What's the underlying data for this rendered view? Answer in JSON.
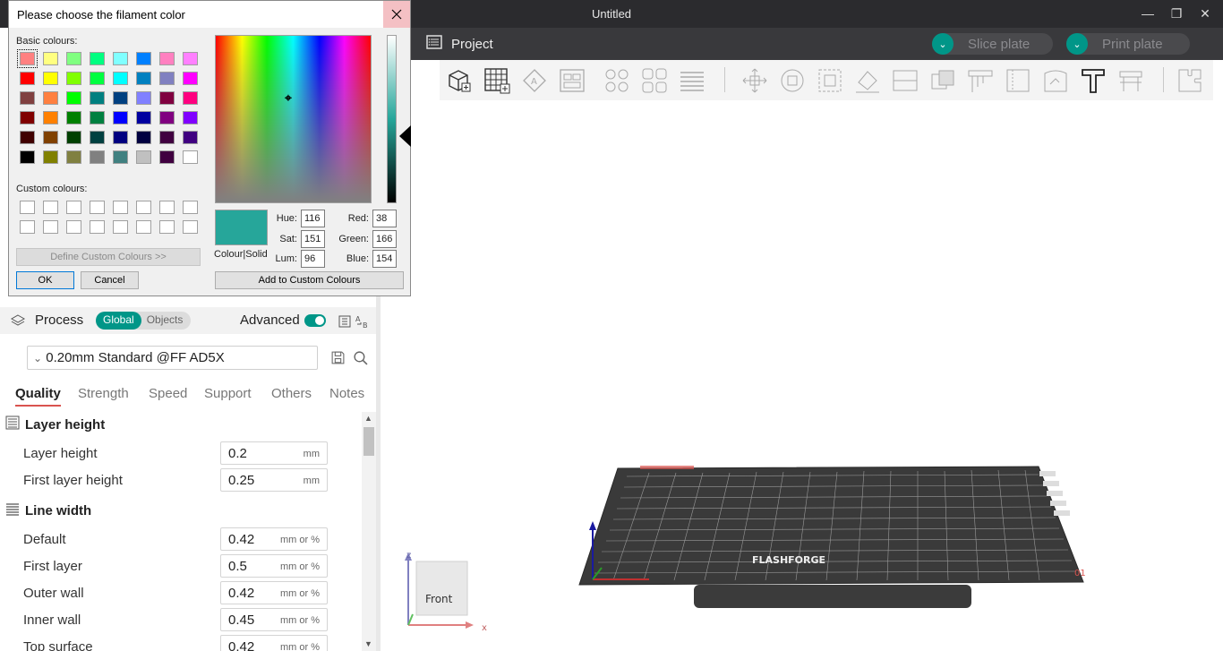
{
  "window": {
    "title": "Untitled"
  },
  "appbar": {
    "project_label": "Project",
    "slice_label": "Slice plate",
    "print_label": "Print plate"
  },
  "colors": {
    "accent": "#009688",
    "selected_color": "#26A69A",
    "dark_bar": "#2b2b2e"
  },
  "toolbar": {
    "tools": [
      "add-object-icon",
      "add-plate-icon",
      "auto-orient-icon",
      "arrange-icon",
      "split-objects-icon",
      "split-parts-icon",
      "layers-icon",
      "move-icon",
      "rotate-icon",
      "scale-icon",
      "lay-on-face-icon",
      "cut-icon",
      "boolean-icon",
      "paint-support-icon",
      "paint-seam-icon",
      "paint-color-icon",
      "text-icon",
      "measure-icon",
      "assembly-icon"
    ]
  },
  "dialog": {
    "title": "Please choose the filament color",
    "basic_label": "Basic colours:",
    "custom_label": "Custom colours:",
    "define_button": "Define Custom Colours >>",
    "ok_button": "OK",
    "cancel_button": "Cancel",
    "add_button": "Add to Custom Colours",
    "colour_solid_label": "Colour|Solid",
    "basic_colours": [
      "#ff8080",
      "#ffff80",
      "#80ff80",
      "#00ff80",
      "#80ffff",
      "#0080ff",
      "#ff80c0",
      "#ff80ff",
      "#ff0000",
      "#ffff00",
      "#80ff00",
      "#00ff40",
      "#00ffff",
      "#0080c0",
      "#8080c0",
      "#ff00ff",
      "#804040",
      "#ff8040",
      "#00ff00",
      "#008080",
      "#004080",
      "#8080ff",
      "#800040",
      "#ff0080",
      "#800000",
      "#ff8000",
      "#008000",
      "#008040",
      "#0000ff",
      "#0000a0",
      "#800080",
      "#8000ff",
      "#400000",
      "#804000",
      "#004000",
      "#004040",
      "#000080",
      "#000040",
      "#400040",
      "#400080",
      "#000000",
      "#808000",
      "#808040",
      "#808080",
      "#408080",
      "#c0c0c0",
      "#400040",
      "#ffffff"
    ],
    "selected_basic_index": 0,
    "fields": {
      "hue_label": "Hue:",
      "hue": "116",
      "sat_label": "Sat:",
      "sat": "151",
      "lum_label": "Lum:",
      "lum": "96",
      "red_label": "Red:",
      "red": "38",
      "green_label": "Green:",
      "green": "166",
      "blue_label": "Blue:",
      "blue": "154"
    }
  },
  "process": {
    "title": "Process",
    "seg_global": "Global",
    "seg_objects": "Objects",
    "advanced_label": "Advanced",
    "advanced_on": true,
    "preset": "0.20mm Standard @FF AD5X",
    "tabs": [
      "Quality",
      "Strength",
      "Speed",
      "Support",
      "Others",
      "Notes"
    ],
    "active_tab": "Quality",
    "sections": [
      {
        "title": "Layer height"
      },
      {
        "title": "Line width"
      }
    ],
    "rows": [
      {
        "label": "Layer height",
        "value": "0.2",
        "unit": "mm"
      },
      {
        "label": "First layer height",
        "value": "0.25",
        "unit": "mm"
      },
      {
        "label": "Default",
        "value": "0.42",
        "unit": "mm or %"
      },
      {
        "label": "First layer",
        "value": "0.5",
        "unit": "mm or %"
      },
      {
        "label": "Outer wall",
        "value": "0.42",
        "unit": "mm or %"
      },
      {
        "label": "Inner wall",
        "value": "0.45",
        "unit": "mm or %"
      },
      {
        "label": "Top surface",
        "value": "0.42",
        "unit": "mm or %"
      }
    ]
  },
  "viewport": {
    "view_cube_label": "Front",
    "axis_z": "z",
    "axis_x": "x",
    "bed_brand": "FLASHFORGE",
    "plate_number": "01"
  }
}
